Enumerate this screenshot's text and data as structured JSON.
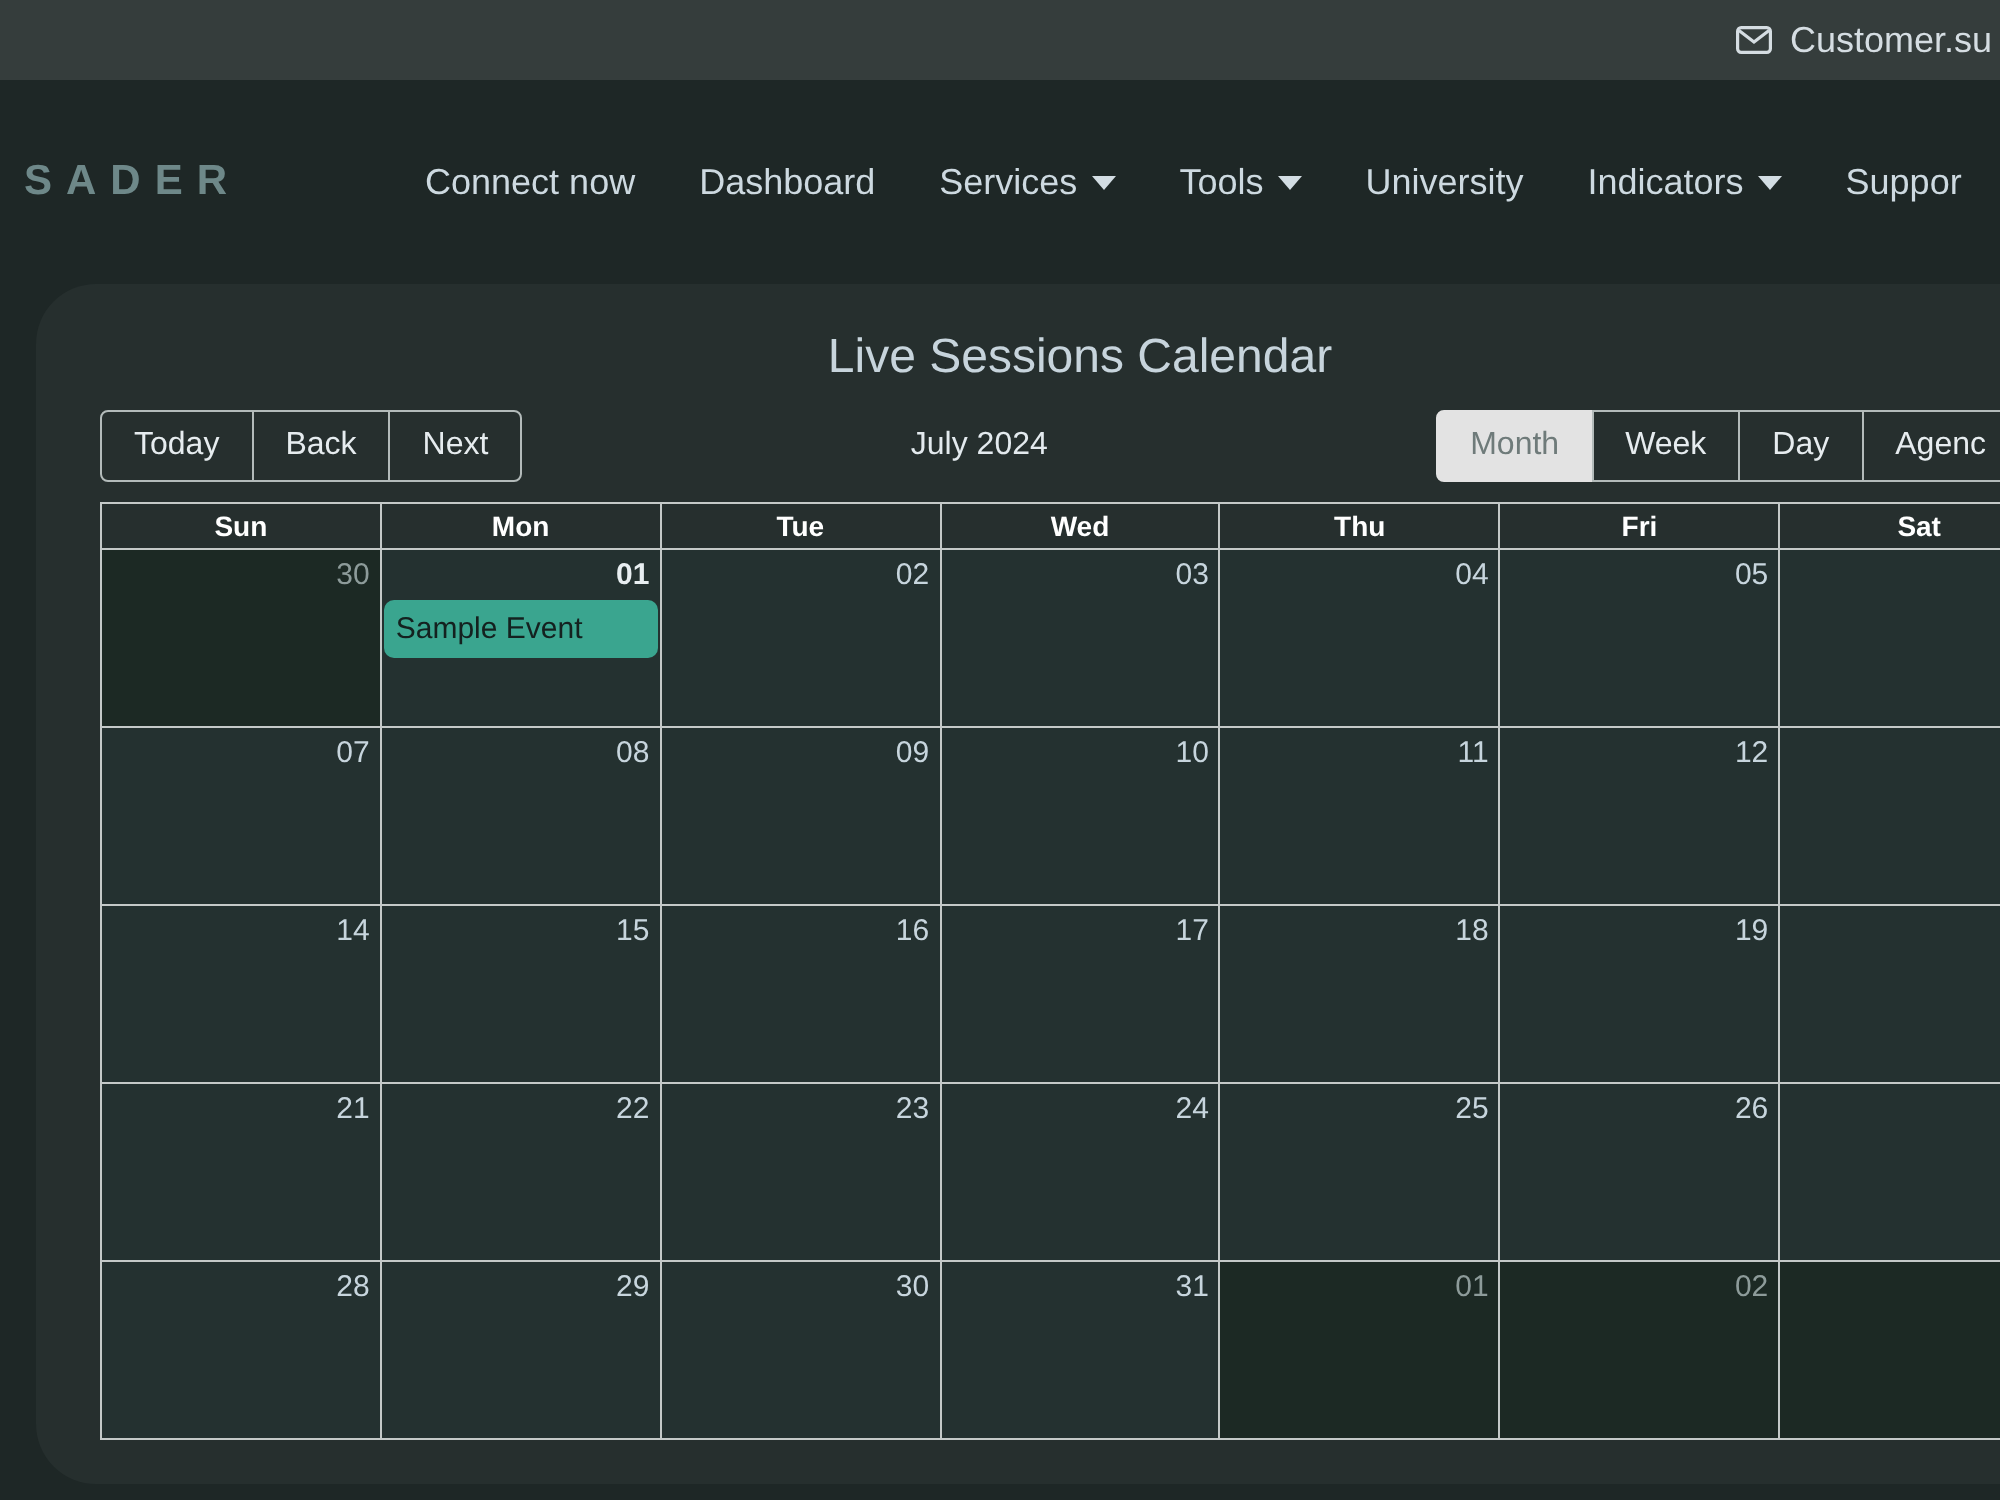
{
  "top_bar": {
    "email": "Customer.su"
  },
  "navbar": {
    "logo": "SADER",
    "items": [
      {
        "label": "Connect now",
        "dropdown": false
      },
      {
        "label": "Dashboard",
        "dropdown": false
      },
      {
        "label": "Services",
        "dropdown": true
      },
      {
        "label": "Tools",
        "dropdown": true
      },
      {
        "label": "University",
        "dropdown": false
      },
      {
        "label": "Indicators",
        "dropdown": true
      },
      {
        "label": "Suppor"
      }
    ]
  },
  "calendar": {
    "title": "Live Sessions Calendar",
    "nav_buttons": [
      "Today",
      "Back",
      "Next"
    ],
    "label": "July 2024",
    "views": [
      {
        "label": "Month",
        "selected": true
      },
      {
        "label": "Week",
        "selected": false
      },
      {
        "label": "Day",
        "selected": false
      },
      {
        "label": "Agenc",
        "selected": false
      }
    ],
    "weekdays": [
      "Sun",
      "Mon",
      "Tue",
      "Wed",
      "Thu",
      "Fri",
      "Sat"
    ],
    "weeks": [
      {
        "days": [
          {
            "date": "30",
            "off_range": true,
            "today": false
          },
          {
            "date": "01",
            "off_range": false,
            "today": true,
            "events": [
              {
                "title": "Sample Event"
              }
            ]
          },
          {
            "date": "02",
            "off_range": false,
            "today": false
          },
          {
            "date": "03",
            "off_range": false,
            "today": false
          },
          {
            "date": "04",
            "off_range": false,
            "today": false
          },
          {
            "date": "05",
            "off_range": false,
            "today": false
          },
          {
            "off_range": false
          }
        ]
      },
      {
        "days": [
          {
            "date": "07",
            "off_range": false,
            "today": false
          },
          {
            "date": "08",
            "off_range": false,
            "today": false
          },
          {
            "date": "09",
            "off_range": false,
            "today": false
          },
          {
            "date": "10",
            "off_range": false,
            "today": false
          },
          {
            "date": "11",
            "off_range": false,
            "today": false
          },
          {
            "date": "12",
            "off_range": false,
            "today": false
          },
          {
            "off_range": false
          }
        ]
      },
      {
        "days": [
          {
            "date": "14",
            "off_range": false,
            "today": false
          },
          {
            "date": "15",
            "off_range": false,
            "today": false
          },
          {
            "date": "16",
            "off_range": false,
            "today": false
          },
          {
            "date": "17",
            "off_range": false,
            "today": false
          },
          {
            "date": "18",
            "off_range": false,
            "today": false
          },
          {
            "date": "19",
            "off_range": false,
            "today": false
          },
          {
            "off_range": false
          }
        ]
      },
      {
        "days": [
          {
            "date": "21",
            "off_range": false,
            "today": false
          },
          {
            "date": "22",
            "off_range": false,
            "today": false
          },
          {
            "date": "23",
            "off_range": false,
            "today": false
          },
          {
            "date": "24",
            "off_range": false,
            "today": false
          },
          {
            "date": "25",
            "off_range": false,
            "today": false
          },
          {
            "date": "26",
            "off_range": false,
            "today": false
          },
          {
            "off_range": false
          }
        ]
      },
      {
        "days": [
          {
            "date": "28",
            "off_range": false,
            "today": false
          },
          {
            "date": "29",
            "off_range": false,
            "today": false
          },
          {
            "date": "30",
            "off_range": false,
            "today": false
          },
          {
            "date": "31",
            "off_range": false,
            "today": false
          },
          {
            "date": "01",
            "off_range": true,
            "today": false
          },
          {
            "date": "02",
            "off_range": true,
            "today": false
          },
          {
            "off_range": true
          }
        ]
      }
    ]
  }
}
